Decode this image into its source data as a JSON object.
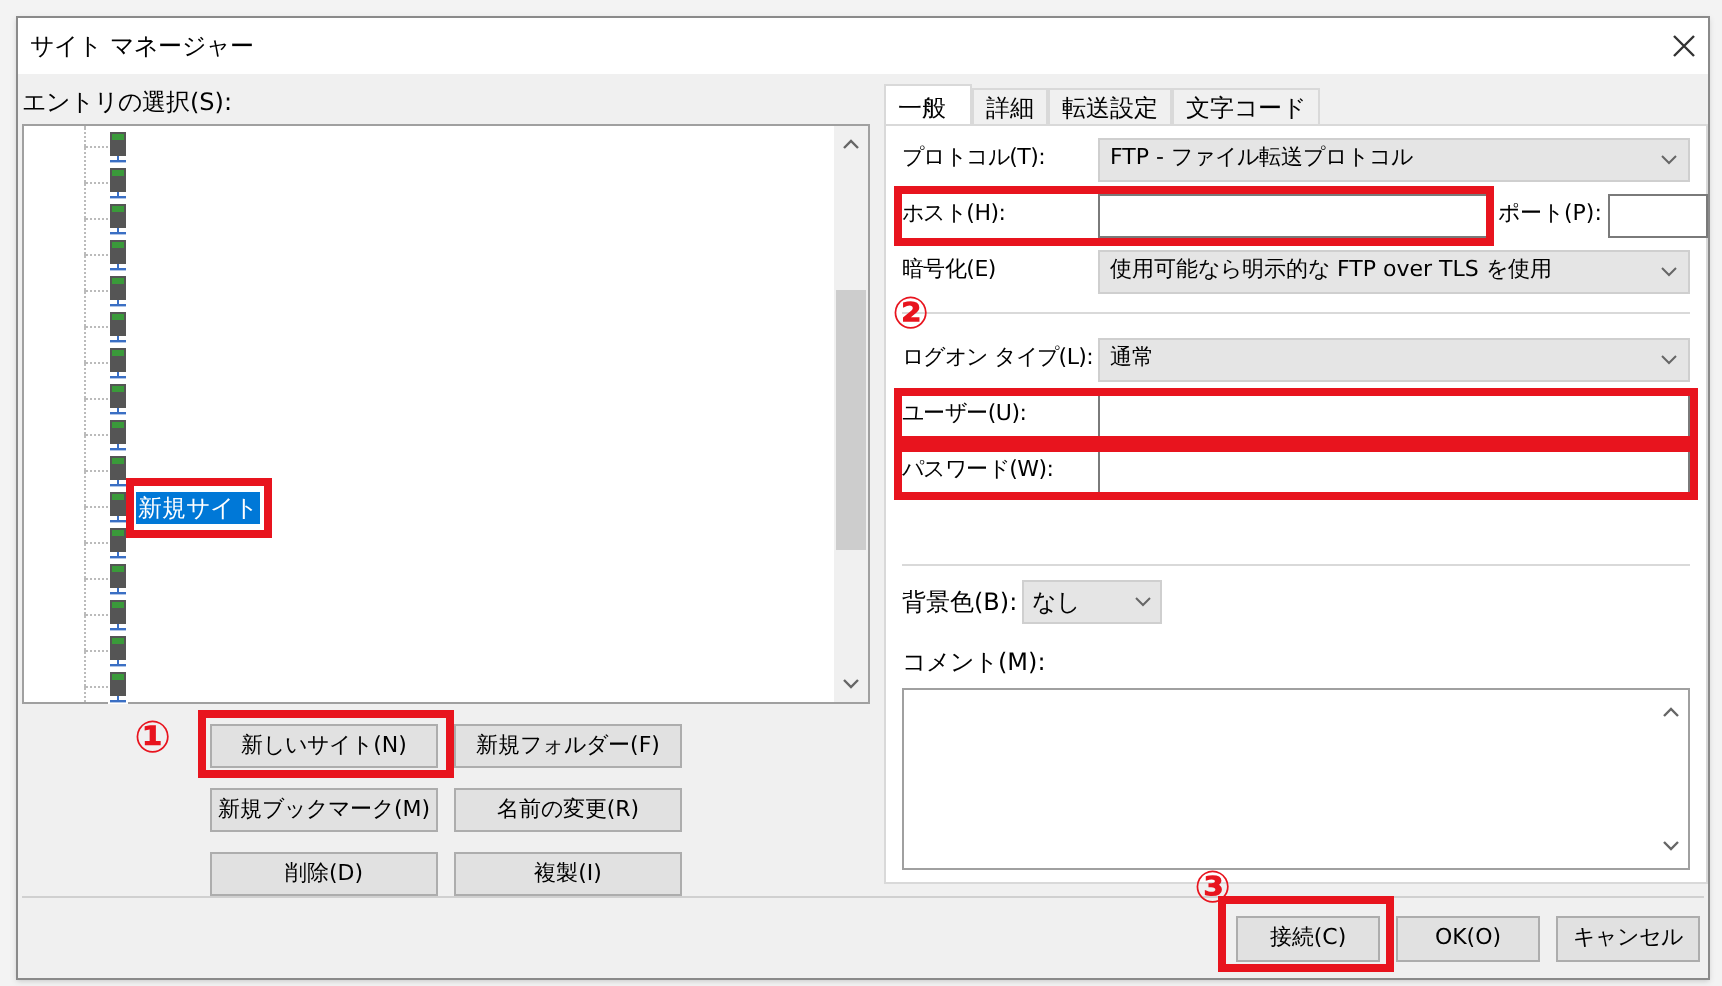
{
  "window": {
    "title": "サイト マネージャー"
  },
  "entries": {
    "label": "エントリの選択(S):",
    "items": [
      {
        "kind": "site",
        "selected": false
      },
      {
        "kind": "site",
        "selected": false
      },
      {
        "kind": "site",
        "selected": false
      },
      {
        "kind": "site",
        "selected": false
      },
      {
        "kind": "site",
        "selected": false
      },
      {
        "kind": "site",
        "selected": false
      },
      {
        "kind": "site",
        "selected": false
      },
      {
        "kind": "site",
        "selected": false
      },
      {
        "kind": "site",
        "selected": false
      },
      {
        "kind": "site",
        "selected": false
      },
      {
        "kind": "site",
        "selected": true,
        "label": "新規サイト",
        "annotated": true
      },
      {
        "kind": "site",
        "selected": false
      },
      {
        "kind": "site",
        "selected": false
      },
      {
        "kind": "site",
        "selected": false
      },
      {
        "kind": "site",
        "selected": false
      },
      {
        "kind": "site",
        "selected": false
      }
    ]
  },
  "entry_buttons": [
    {
      "label": "新しいサイト(N)",
      "annotated": true,
      "marker": "①"
    },
    {
      "label": "新規フォルダー(F)"
    },
    {
      "label": "新規ブックマーク(M)"
    },
    {
      "label": "名前の変更(R)"
    },
    {
      "label": "削除(D)"
    },
    {
      "label": "複製(I)"
    }
  ],
  "tabs": [
    {
      "label": "一般",
      "selected": true
    },
    {
      "label": "詳細",
      "selected": false
    },
    {
      "label": "転送設定",
      "selected": false
    },
    {
      "label": "文字コード",
      "selected": false
    }
  ],
  "form": {
    "marker": "②",
    "fields": [
      {
        "kind": "select",
        "label": "プロトコル(T):",
        "value": "FTP - ファイル転送プロトコル"
      },
      {
        "kind": "host",
        "label": "ホスト(H):",
        "annotated": true,
        "port_label": "ポート(P):"
      },
      {
        "kind": "select",
        "label": "暗号化(E)",
        "value": "使用可能なら明示的な FTP over TLS を使用"
      },
      {
        "kind": "separator"
      },
      {
        "kind": "select",
        "label": "ログオン タイプ(L):",
        "value": "通常"
      },
      {
        "kind": "input",
        "label": "ユーザー(U):",
        "annotated": true
      },
      {
        "kind": "input",
        "label": "パスワード(W):",
        "annotated": true
      }
    ]
  },
  "background_color": {
    "label": "背景色(B):",
    "value": "なし"
  },
  "comment": {
    "label": "コメント(M):"
  },
  "dialog_buttons": [
    {
      "label": "接続(C)",
      "annotated": true,
      "marker": "③"
    },
    {
      "label": "OK(O)"
    },
    {
      "label": "キャンセル"
    }
  ]
}
